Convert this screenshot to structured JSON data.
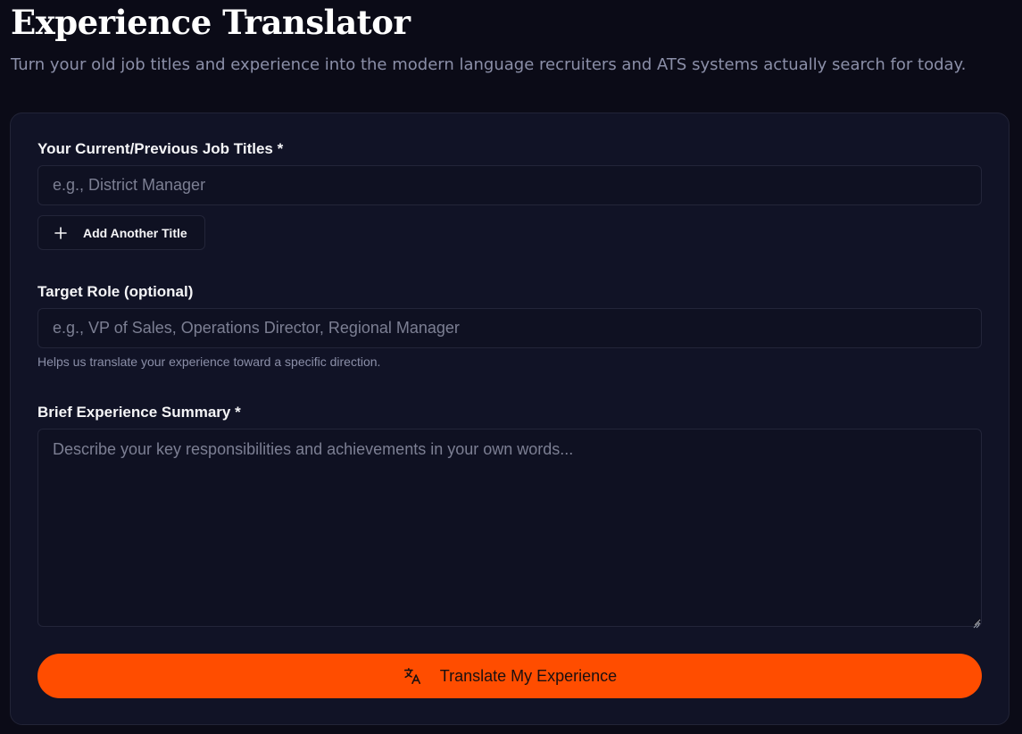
{
  "header": {
    "title": "Experience Translator",
    "subtitle": "Turn your old job titles and experience into the modern language recruiters and ATS systems actually search for today."
  },
  "form": {
    "job_titles": {
      "label": "Your Current/Previous Job Titles *",
      "placeholder": "e.g., District Manager",
      "value": ""
    },
    "add_title_button": {
      "label": "Add Another Title",
      "icon": "plus-icon"
    },
    "target_role": {
      "label": "Target Role (optional)",
      "placeholder": "e.g., VP of Sales, Operations Director, Regional Manager",
      "value": "",
      "helper": "Helps us translate your experience toward a specific direction."
    },
    "summary": {
      "label": "Brief Experience Summary *",
      "placeholder": "Describe your key responsibilities and achievements in your own words...",
      "value": ""
    },
    "submit_button": {
      "label": "Translate My Experience",
      "icon": "translate-icon"
    }
  },
  "colors": {
    "background": "#0b0b17",
    "card": "#111326",
    "accent": "#ff4d00",
    "muted_text": "#8b8fa8"
  }
}
